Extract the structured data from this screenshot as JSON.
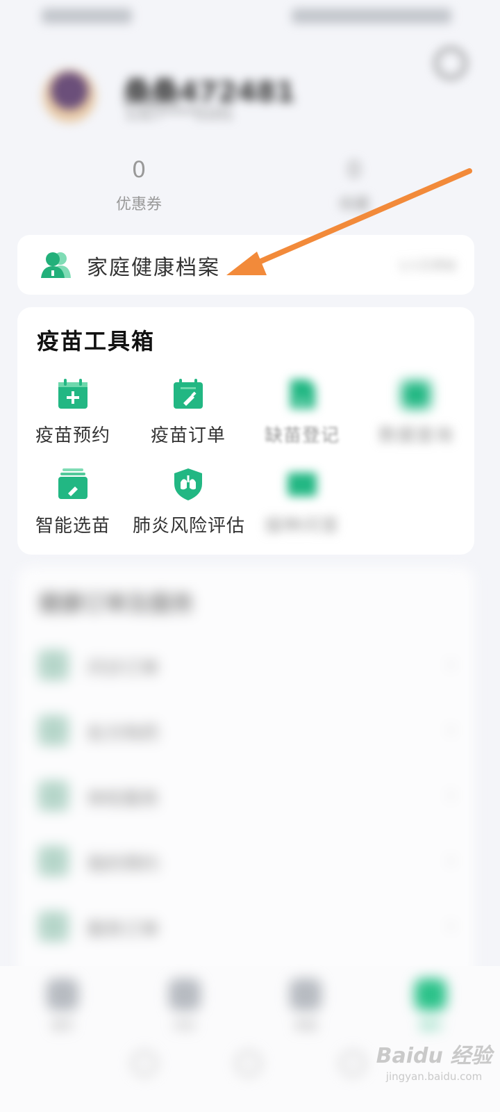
{
  "profile": {
    "username": "桑桑472481",
    "subtitle": "1327****5101"
  },
  "stats": [
    {
      "value": "0",
      "label": "优惠券"
    },
    {
      "value": "0",
      "label": "收藏"
    }
  ],
  "family_card": {
    "title": "家庭健康档案",
    "right_text": "1人已添加"
  },
  "toolbox": {
    "title": "疫苗工具箱",
    "items": [
      {
        "label": "疫苗预约",
        "icon": "calendar-plus-icon"
      },
      {
        "label": "疫苗订单",
        "icon": "calendar-syringe-icon"
      },
      {
        "label": "缺苗登记",
        "icon": "document-icon"
      },
      {
        "label": "数据查询",
        "icon": "folder-icon"
      },
      {
        "label": "智能选苗",
        "icon": "layered-syringe-icon"
      },
      {
        "label": "肺炎风险评估",
        "icon": "lungs-shield-icon"
      },
      {
        "label": "接种问答",
        "icon": "card-icon"
      }
    ]
  },
  "orders": {
    "title": "健康订单及服务",
    "rows": [
      {
        "label": "问诊订单"
      },
      {
        "label": "处方购药"
      },
      {
        "label": "体检服务"
      },
      {
        "label": "我的预约"
      },
      {
        "label": "服务订单"
      }
    ]
  },
  "bottom_nav": [
    {
      "label": "首页",
      "icon": "home-icon"
    },
    {
      "label": "问诊",
      "icon": "clipboard-icon"
    },
    {
      "label": "商城",
      "icon": "chat-icon"
    },
    {
      "label": "我的",
      "icon": "person-icon",
      "active": true
    }
  ],
  "watermark": {
    "main": "Baidu 经验",
    "sub": "jingyan.baidu.com"
  },
  "colors": {
    "accent": "#2cc28a",
    "arrow": "#f28a3a"
  }
}
